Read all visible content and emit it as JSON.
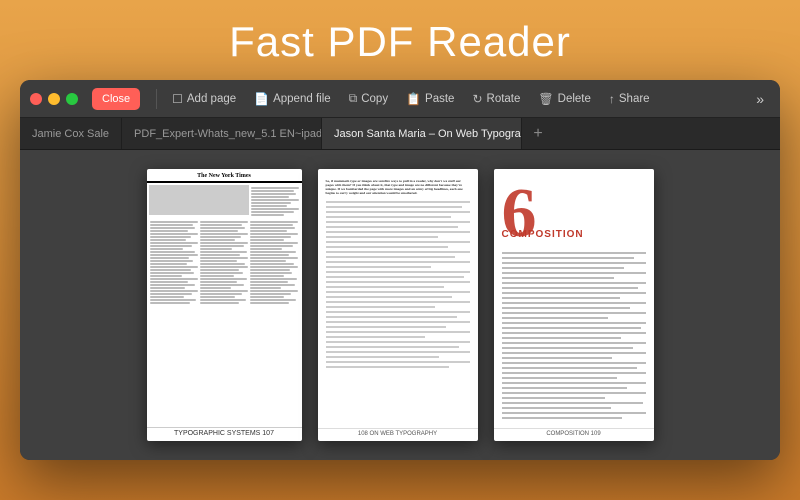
{
  "app": {
    "title": "Fast PDF Reader"
  },
  "toolbar": {
    "close_label": "Close",
    "add_page_label": "Add page",
    "append_file_label": "Append file",
    "copy_label": "Copy",
    "paste_label": "Paste",
    "rotate_label": "Rotate",
    "delete_label": "Delete",
    "share_label": "Share",
    "more_label": "»"
  },
  "tabs": [
    {
      "id": "tab1",
      "label": "Jamie Cox Sale",
      "active": false,
      "closeable": false
    },
    {
      "id": "tab2",
      "label": "PDF_Expert-Whats_new_5.1 EN~ipad",
      "active": false,
      "closeable": true
    },
    {
      "id": "tab3",
      "label": "Jason Santa Maria – On Web Typogra...",
      "active": true,
      "closeable": true
    }
  ],
  "pages": [
    {
      "id": "page-107",
      "type": "newspaper",
      "number": "107",
      "number_label": "TYPOGRAPHIC SYSTEMS  107"
    },
    {
      "id": "page-108",
      "type": "text",
      "number": "108",
      "number_label": "108  ON WEB TYPOGRAPHY"
    },
    {
      "id": "page-109",
      "type": "composition",
      "number": "109",
      "big_number": "6",
      "title": "COMPOSITION",
      "number_label": "COMPOSITION  109"
    }
  ]
}
